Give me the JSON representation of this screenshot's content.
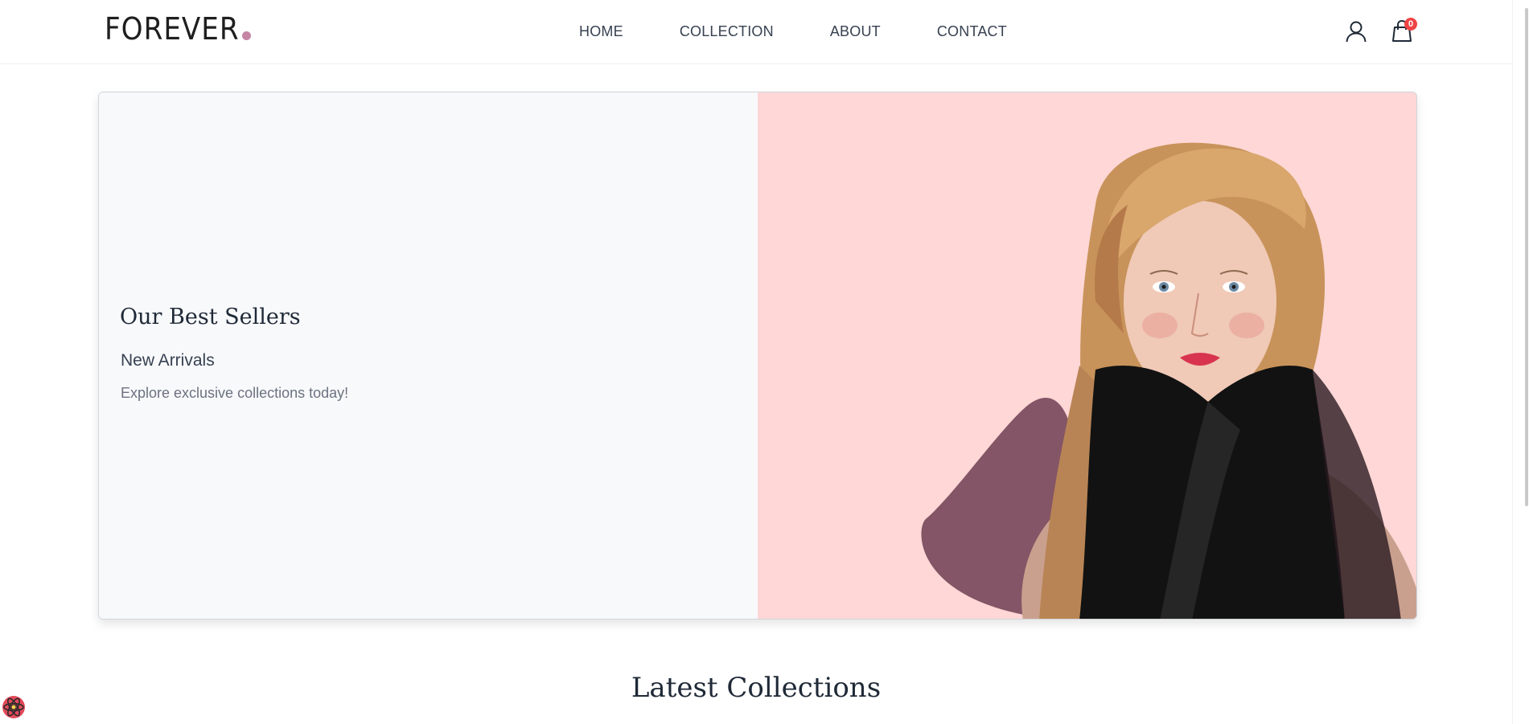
{
  "brand": {
    "logo_text": "FOREVER",
    "accent_color": "#c586a5"
  },
  "nav": {
    "items": [
      {
        "label": "HOME"
      },
      {
        "label": "COLLECTION"
      },
      {
        "label": "ABOUT"
      },
      {
        "label": "CONTACT"
      }
    ]
  },
  "header_icons": {
    "profile_icon": "user-icon",
    "cart_icon": "shopping-bag-icon",
    "cart_count": "0",
    "badge_color": "#ef4444"
  },
  "hero": {
    "title": "Our Best Sellers",
    "subtitle": "New Arrivals",
    "description": "Explore exclusive collections today!",
    "image_background": "#fed7d6"
  },
  "section": {
    "title": "Latest Collections"
  },
  "devtools": {
    "icon": "react-devtools-icon"
  }
}
